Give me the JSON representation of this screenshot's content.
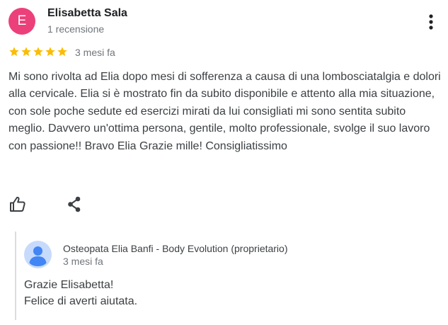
{
  "review": {
    "avatar_letter": "E",
    "avatar_color": "#ec407a",
    "author": "Elisabetta Sala",
    "author_meta": "1 recensione",
    "rating": 5,
    "rating_max": 5,
    "star_color": "#fbbc04",
    "date": "3 mesi fa",
    "text": "Mi sono rivolta ad Elia dopo mesi di sofferenza a causa di una lombosciatalgia e dolori alla cervicale. Elia si è mostrato fin da subito disponibile e attento alla mia situazione, con sole poche sedute ed esercizi mirati da lui consigliati mi sono sentita subito meglio. Davvero un'ottima persona, gentile, molto professionale, svolge il suo lavoro con passione!! Bravo Elia Grazie mille! Consigliatissimo",
    "actions": {
      "menu_icon": "more-vert-icon",
      "like_icon": "thumb-up-icon",
      "share_icon": "share-icon"
    }
  },
  "owner_reply": {
    "avatar_icon": "person-icon",
    "avatar_color": "#4285f4",
    "name": "Osteopata Elia Banfi - Body Evolution (proprietario)",
    "date": "3 mesi fa",
    "lines": [
      "Grazie Elisabetta!",
      "Felice di averti aiutata."
    ]
  }
}
